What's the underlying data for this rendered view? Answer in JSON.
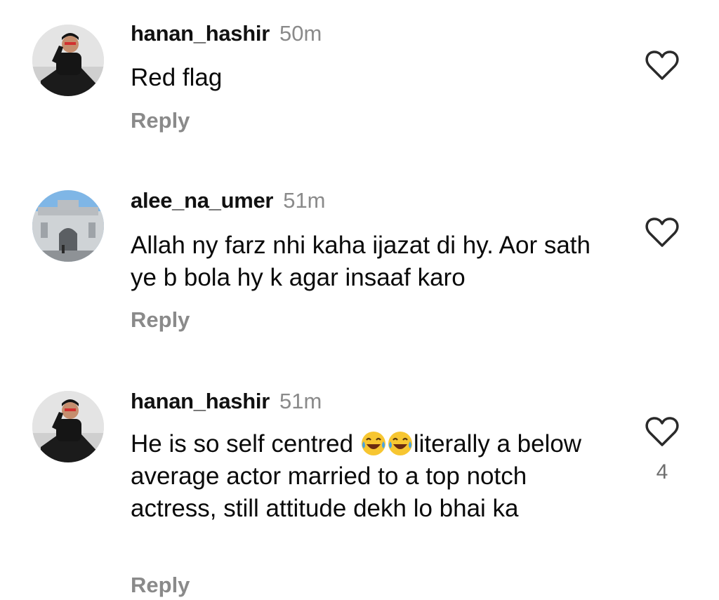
{
  "comments": [
    {
      "username": "hanan_hashir",
      "time": "50m",
      "text": "Red flag",
      "reply_label": "Reply",
      "avatar_icon": "man-in-black-shirt-avatar",
      "like_icon": "heart-outline-icon"
    },
    {
      "username": "alee_na_umer",
      "time": "51m",
      "text": "Allah ny farz nhi kaha ijazat di hy. Aor sath ye b bola hy k agar insaaf karo",
      "reply_label": "Reply",
      "avatar_icon": "palace-building-avatar",
      "like_icon": "heart-outline-icon"
    },
    {
      "username": "hanan_hashir",
      "time": "51m",
      "text_before_emoji": "He is so self centred ",
      "emoji": [
        "😂",
        "😂"
      ],
      "emoji_name": "face-with-tears-of-joy-icon",
      "text_after_emoji": "literally a below average actor married to a top notch actress, still attitude dekh lo bhai ka",
      "reply_label": "Reply",
      "avatar_icon": "man-in-black-shirt-avatar",
      "like_icon": "heart-outline-icon",
      "like_count": "4"
    }
  ],
  "colors": {
    "text": "#000000",
    "secondary": "#8a8a8a",
    "heart_stroke": "#2a2a2a",
    "emoji_face": "#f7c631",
    "emoji_tears": "#4aa3df"
  }
}
